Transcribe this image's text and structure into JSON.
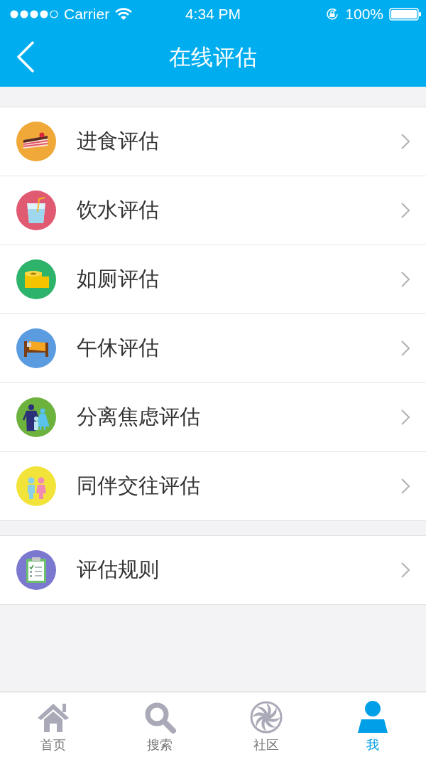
{
  "status_bar": {
    "carrier": "Carrier",
    "time": "4:34 PM",
    "battery": "100%"
  },
  "nav_bar": {
    "title": "在线评估"
  },
  "sections": [
    {
      "items": [
        {
          "label": "进食评估",
          "kind": "cake",
          "color": "#f0a838"
        },
        {
          "label": "饮水评估",
          "kind": "drink",
          "color": "#e05a72"
        },
        {
          "label": "如厕评估",
          "kind": "toilet-paper",
          "color": "#2db36a"
        },
        {
          "label": "午休评估",
          "kind": "bed",
          "color": "#5b9be0"
        },
        {
          "label": "分离焦虑评估",
          "kind": "family",
          "color": "#6cb23c"
        },
        {
          "label": "同伴交往评估",
          "kind": "kids",
          "color": "#f2e33a"
        }
      ]
    },
    {
      "items": [
        {
          "label": "评估规则",
          "kind": "clipboard",
          "color": "#7b78d0"
        }
      ]
    }
  ],
  "tab_bar": [
    {
      "label": "首页",
      "kind": "home",
      "selected": false
    },
    {
      "label": "搜索",
      "kind": "search",
      "selected": false
    },
    {
      "label": "社区",
      "kind": "community",
      "selected": false
    },
    {
      "label": "我",
      "kind": "profile",
      "selected": true
    }
  ]
}
